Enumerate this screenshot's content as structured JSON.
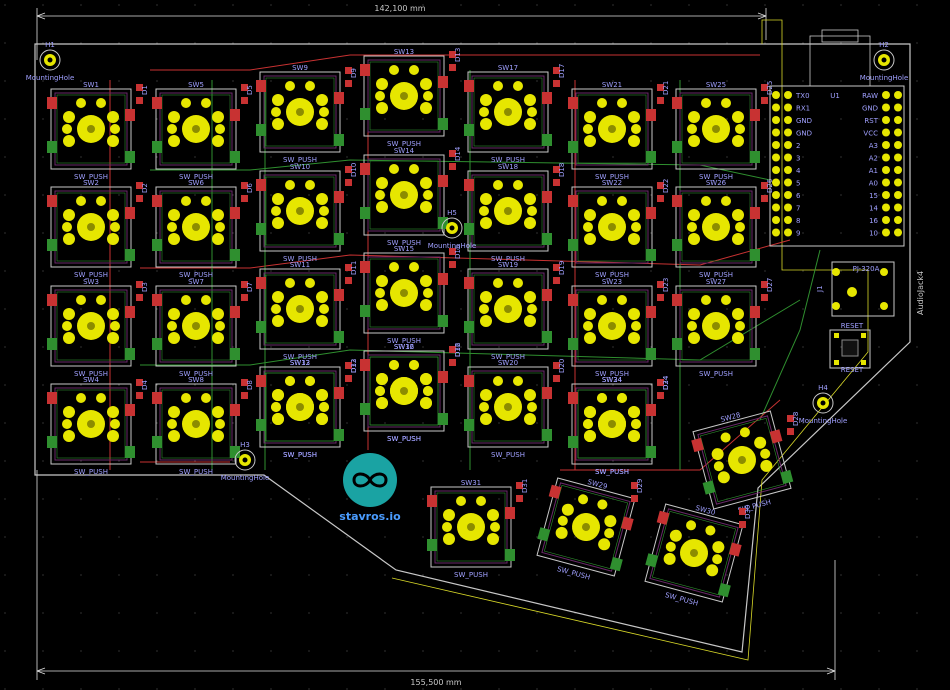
{
  "board": {
    "top_dimension": "142,100 mm",
    "bottom_dimension": "155,500 mm",
    "logo_text": "stavros.io",
    "audio_label": "AudioJack4",
    "reset_label": "RESET",
    "reset_ref": "RESET",
    "jack_ref": "PJ-320A",
    "jack_value": "J1",
    "mcu_ref": "U1"
  },
  "mounting_holes": [
    {
      "ref": "H1",
      "label": "MountingHole"
    },
    {
      "ref": "H2",
      "label": "MountingHole"
    },
    {
      "ref": "H3",
      "label": "MountingHole"
    },
    {
      "ref": "H4",
      "label": "MountingHole"
    },
    {
      "ref": "H5",
      "label": "MountingHole"
    }
  ],
  "switches": [
    {
      "ref": "SW1",
      "value": "SW_PUSH"
    },
    {
      "ref": "SW2",
      "value": "SW_PUSH"
    },
    {
      "ref": "SW3",
      "value": "SW_PUSH"
    },
    {
      "ref": "SW4",
      "value": "SW_PUSH"
    },
    {
      "ref": "SW5",
      "value": "SW_PUSH"
    },
    {
      "ref": "SW6",
      "value": "SW_PUSH"
    },
    {
      "ref": "SW7",
      "value": "SW_PUSH"
    },
    {
      "ref": "SW8",
      "value": "SW_PUSH"
    },
    {
      "ref": "SW9",
      "value": "SW_PUSH"
    },
    {
      "ref": "SW10",
      "value": "SW_PUSH"
    },
    {
      "ref": "SW11",
      "value": "SW_PUSH"
    },
    {
      "ref": "SW12",
      "value": "SW_PUSH"
    },
    {
      "ref": "SW13",
      "value": "SW_PUSH"
    },
    {
      "ref": "SW14",
      "value": "SW_PUSH"
    },
    {
      "ref": "SW15",
      "value": "SW_PUSH"
    },
    {
      "ref": "SW16",
      "value": "SW_PUSH"
    },
    {
      "ref": "SW17",
      "value": "SW_PUSH"
    },
    {
      "ref": "SW18",
      "value": "SW_PUSH"
    },
    {
      "ref": "SW19",
      "value": "SW_PUSH"
    },
    {
      "ref": "SW20",
      "value": "SW_PUSH"
    },
    {
      "ref": "SW21",
      "value": "SW_PUSH"
    },
    {
      "ref": "SW22",
      "value": "SW_PUSH"
    },
    {
      "ref": "SW23",
      "value": "SW_PUSH"
    },
    {
      "ref": "SW24",
      "value": "SW_PUSH"
    },
    {
      "ref": "SW25",
      "value": "SW_PUSH"
    },
    {
      "ref": "SW26",
      "value": "SW_PUSH"
    },
    {
      "ref": "SW27",
      "value": "SW_PUSH"
    },
    {
      "ref": "SW28",
      "value": "SW_PUSH"
    },
    {
      "ref": "SW29",
      "value": "SW_PUSH"
    },
    {
      "ref": "SW30",
      "value": "SW_PUSH"
    },
    {
      "ref": "SW31",
      "value": "SW_PUSH"
    },
    {
      "ref": "SW32",
      "value": "SW_PUSH"
    },
    {
      "ref": "SW33",
      "value": "SW_PUSH"
    },
    {
      "ref": "SW34",
      "value": "SW_PUSH"
    }
  ],
  "diodes": [
    "D1",
    "D2",
    "D3",
    "D4",
    "D5",
    "D6",
    "D7",
    "D8",
    "D9",
    "D10",
    "D11",
    "D12",
    "D13",
    "D14",
    "D15",
    "D16",
    "D17",
    "D18",
    "D19",
    "D20",
    "D21",
    "D22",
    "D23",
    "D24",
    "D25",
    "D26",
    "D27",
    "D28",
    "D29",
    "D30",
    "D31",
    "D32",
    "D33",
    "D34"
  ],
  "mcu_pins_left": [
    "TX0",
    "RX1",
    "GND",
    "GND",
    "2",
    "3",
    "4",
    "5",
    "6",
    "7",
    "8",
    "9"
  ],
  "mcu_pins_right": [
    "RAW",
    "GND",
    "RST",
    "VCC",
    "A3",
    "A2",
    "A1",
    "A0",
    "15",
    "14",
    "16",
    "10"
  ],
  "colors": {
    "background": "#000000",
    "pad": "#e6e600",
    "front_copper": "#c83232",
    "back_copper": "#2f8f2f",
    "silk": "#c8c8c8",
    "edge_cuts": "#c8c8c8",
    "courtyard": "#ff00ff",
    "fab": "#4a7cff",
    "logo": "#1aa3a3"
  }
}
